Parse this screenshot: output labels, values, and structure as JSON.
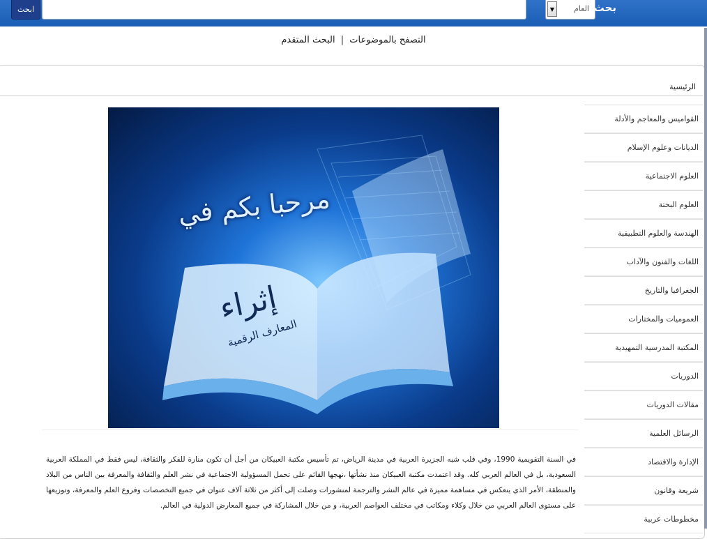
{
  "search": {
    "title": "بحث",
    "scope_value": "العام",
    "button_label": "ابحث"
  },
  "subnav": {
    "advanced_search": "البحث المتقدم",
    "separator": "|",
    "browse_topics": "التصفح بالموضوعات"
  },
  "breadcrumb": "الرئيسية",
  "sidebar": {
    "items": [
      {
        "label": "القواميس والمعاجم والأدلة"
      },
      {
        "label": "الديانات وعلوم الإسلام"
      },
      {
        "label": "العلوم الاجتماعية"
      },
      {
        "label": "العلوم البحتة"
      },
      {
        "label": "الهندسة والعلوم التطبيقية"
      },
      {
        "label": "اللغات والفنون والآداب"
      },
      {
        "label": "الجغرافيا والتاريخ"
      },
      {
        "label": "العموميات والمختارات"
      },
      {
        "label": "المكتبة المدرسية التمهيدية"
      },
      {
        "label": "الدوريات"
      },
      {
        "label": "مقالات الدوريات"
      },
      {
        "label": "الرسائل العلمية"
      },
      {
        "label": "الإدارة والاقتصاد"
      },
      {
        "label": "شريعة وقانون"
      },
      {
        "label": "مخطوطات عربية"
      }
    ]
  },
  "hero": {
    "welcome": "مرحبا بكم في",
    "brand": "إثراء",
    "brand_sub": "المعارف الرقمية"
  },
  "intro_text": "في السنة التقويمية 1990، وفي قلب شبه الجزيرة العربية في مدينة الرياض، تم تأسيس مكتبة العبيكان من أجل أن تكون منارة للفكر والثقافة، ليس فقط في المملكة العربية السعودية، بل في العالم العربي كله. وقد اعتمدت مكتبة العبيكان منذ نشأتها ،نهجها القائم على تحمل المسؤولية الاجتماعية في نشر العلم والثقافة والمعرفة بين الناس من البلاد والمنطقة، الأمر الذي ينعكس في مساهمة مميزة في عالم النشر والترجمة لمنشورات وصلت إلى أكثر من ثلاثة آلاف عنوان في جميع التخصصات وفروع العلم والمعرفة، وتوزيعها على مستوى العالم العربي من خلال وكلاء ومكاتب في مختلف العواصم العربية، و من خلال المشاركة في جميع المعارض الدولية في العالم."
}
